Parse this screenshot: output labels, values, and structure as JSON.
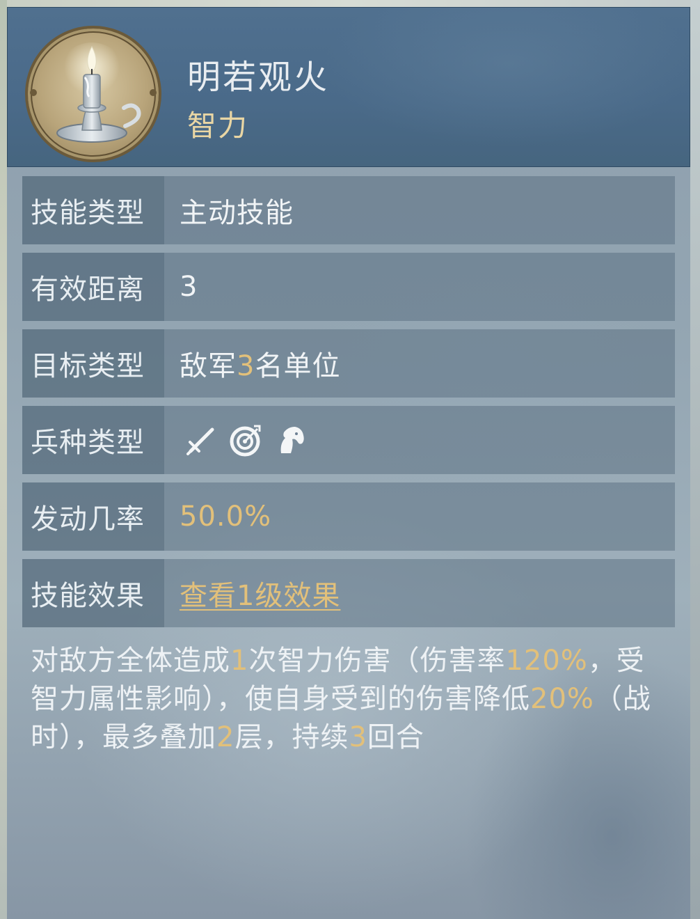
{
  "skill": {
    "name": "明若观火",
    "category": "智力",
    "icon": "candle-icon"
  },
  "rows": {
    "type": {
      "label": "技能类型",
      "value": "主动技能"
    },
    "range": {
      "label": "有效距离",
      "value": "3"
    },
    "target": {
      "label": "目标类型",
      "value_prefix": "敌军",
      "value_number": "3",
      "value_suffix": "名单位"
    },
    "troops": {
      "label": "兵种类型",
      "icons": [
        "sword-icon",
        "bow-target-icon",
        "horse-icon"
      ]
    },
    "chance": {
      "label": "发动几率",
      "value": "50.0%"
    },
    "effect": {
      "label": "技能效果",
      "link_text": "查看1级效果"
    }
  },
  "description": {
    "p1": "对敌方全体造成",
    "n1": "1",
    "p2": "次智力伤害（伤害率",
    "n2": "120%",
    "p3": "，受智力属性影响），使自身受到的伤害降低",
    "n3": "20%",
    "p4": "（战时），最多叠加",
    "n4": "2",
    "p5": "层，持续",
    "n5": "3",
    "p6": "回合"
  },
  "colors": {
    "highlight": "#e2c07a",
    "text": "#eef2f5",
    "header_bg": "#4a6a89"
  }
}
